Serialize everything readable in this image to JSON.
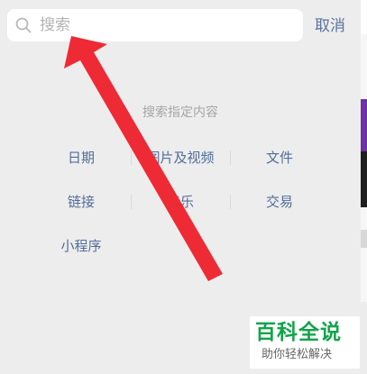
{
  "search": {
    "placeholder": "搜索"
  },
  "header": {
    "cancel_label": "取消"
  },
  "main": {
    "hint": "搜索指定内容",
    "categories": [
      "日期",
      "图片及视频",
      "文件",
      "链接",
      "音乐",
      "交易",
      "小程序"
    ]
  },
  "watermark": {
    "title": "百科全说",
    "subtitle": "助你轻松解决"
  },
  "colors": {
    "page_background": "#ededed",
    "link_blue": "#59739e",
    "annotation_red": "#ee2a35",
    "watermark_green": "#11a44a"
  },
  "icons": {
    "search": "search-icon",
    "annotation": "arrow-icon"
  }
}
